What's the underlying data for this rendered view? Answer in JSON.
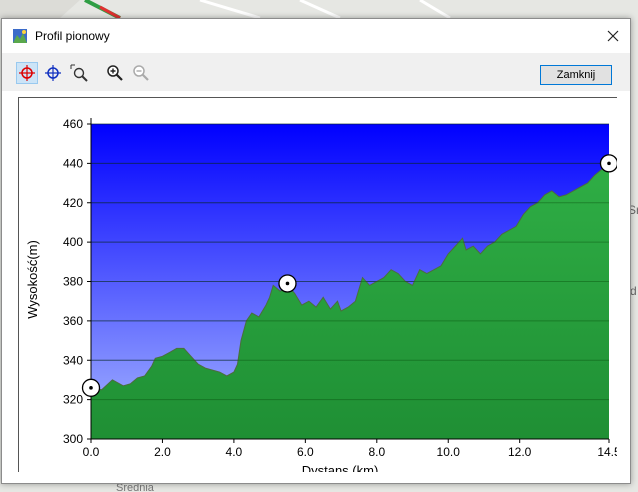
{
  "window": {
    "title": "Profil pionowy",
    "close_glyph": "✕"
  },
  "toolbar": {
    "tools": [
      {
        "name": "select-crosshair-tool",
        "icon": "crosshair-red-icon",
        "active": true
      },
      {
        "name": "move-crosshair-tool",
        "icon": "crosshair-blue-icon",
        "active": false
      },
      {
        "name": "zoom-window-tool",
        "icon": "zoom-window-icon",
        "active": false
      },
      {
        "name": "zoom-in-tool",
        "icon": "zoom-in-icon",
        "active": false
      },
      {
        "name": "zoom-out-tool",
        "icon": "zoom-out-icon",
        "active": false
      }
    ],
    "close_label": "Zamknij"
  },
  "map_fragments": {
    "sr_label": "Sr",
    "d_label": "d",
    "bottom_label": "Średnia"
  },
  "colors": {
    "sky_top": "#0000ff",
    "sky_bottom": "#a8b8ff",
    "terrain": "#2a9a3a",
    "terrain_dark": "#1d7a2a"
  },
  "chart_data": {
    "type": "area",
    "xlabel": "Dystans  (km)",
    "ylabel": "Wysokość(m)",
    "xlim": [
      0,
      14.5
    ],
    "ylim": [
      300,
      460
    ],
    "x_ticks": [
      "0.0",
      "2.0",
      "4.0",
      "6.0",
      "8.0",
      "10.0",
      "12.0",
      "14.5"
    ],
    "y_ticks": [
      "300",
      "320",
      "340",
      "360",
      "380",
      "400",
      "420",
      "440",
      "460"
    ],
    "grid": true,
    "points": [
      [
        0.0,
        326
      ],
      [
        0.3,
        325
      ],
      [
        0.6,
        330
      ],
      [
        0.9,
        327
      ],
      [
        1.1,
        328
      ],
      [
        1.3,
        331
      ],
      [
        1.5,
        332
      ],
      [
        1.7,
        337
      ],
      [
        1.8,
        341
      ],
      [
        2.0,
        342
      ],
      [
        2.2,
        344
      ],
      [
        2.4,
        346
      ],
      [
        2.6,
        346
      ],
      [
        2.8,
        342
      ],
      [
        3.0,
        338
      ],
      [
        3.2,
        336
      ],
      [
        3.4,
        335
      ],
      [
        3.6,
        334
      ],
      [
        3.8,
        332
      ],
      [
        4.0,
        334
      ],
      [
        4.1,
        338
      ],
      [
        4.2,
        350
      ],
      [
        4.35,
        360
      ],
      [
        4.5,
        364
      ],
      [
        4.7,
        362
      ],
      [
        4.9,
        368
      ],
      [
        5.0,
        372
      ],
      [
        5.1,
        378
      ],
      [
        5.3,
        375
      ],
      [
        5.5,
        378
      ],
      [
        5.7,
        374
      ],
      [
        5.9,
        368
      ],
      [
        6.1,
        370
      ],
      [
        6.3,
        367
      ],
      [
        6.5,
        372
      ],
      [
        6.7,
        366
      ],
      [
        6.9,
        370
      ],
      [
        7.0,
        365
      ],
      [
        7.2,
        367
      ],
      [
        7.4,
        370
      ],
      [
        7.5,
        376
      ],
      [
        7.6,
        382
      ],
      [
        7.8,
        378
      ],
      [
        8.0,
        380
      ],
      [
        8.2,
        382
      ],
      [
        8.4,
        386
      ],
      [
        8.6,
        384
      ],
      [
        8.8,
        380
      ],
      [
        9.0,
        378
      ],
      [
        9.2,
        386
      ],
      [
        9.4,
        384
      ],
      [
        9.6,
        386
      ],
      [
        9.8,
        388
      ],
      [
        10.0,
        394
      ],
      [
        10.2,
        398
      ],
      [
        10.4,
        402
      ],
      [
        10.5,
        396
      ],
      [
        10.7,
        398
      ],
      [
        10.9,
        394
      ],
      [
        11.1,
        398
      ],
      [
        11.3,
        400
      ],
      [
        11.5,
        404
      ],
      [
        11.7,
        406
      ],
      [
        11.9,
        408
      ],
      [
        12.1,
        414
      ],
      [
        12.3,
        418
      ],
      [
        12.5,
        420
      ],
      [
        12.7,
        424
      ],
      [
        12.9,
        426
      ],
      [
        13.1,
        423
      ],
      [
        13.3,
        424
      ],
      [
        13.5,
        426
      ],
      [
        13.7,
        428
      ],
      [
        13.9,
        430
      ],
      [
        14.1,
        434
      ],
      [
        14.3,
        437
      ],
      [
        14.5,
        440
      ]
    ],
    "markers": [
      {
        "x": 0.0,
        "y": 326
      },
      {
        "x": 5.5,
        "y": 379
      },
      {
        "x": 14.5,
        "y": 440
      }
    ]
  }
}
